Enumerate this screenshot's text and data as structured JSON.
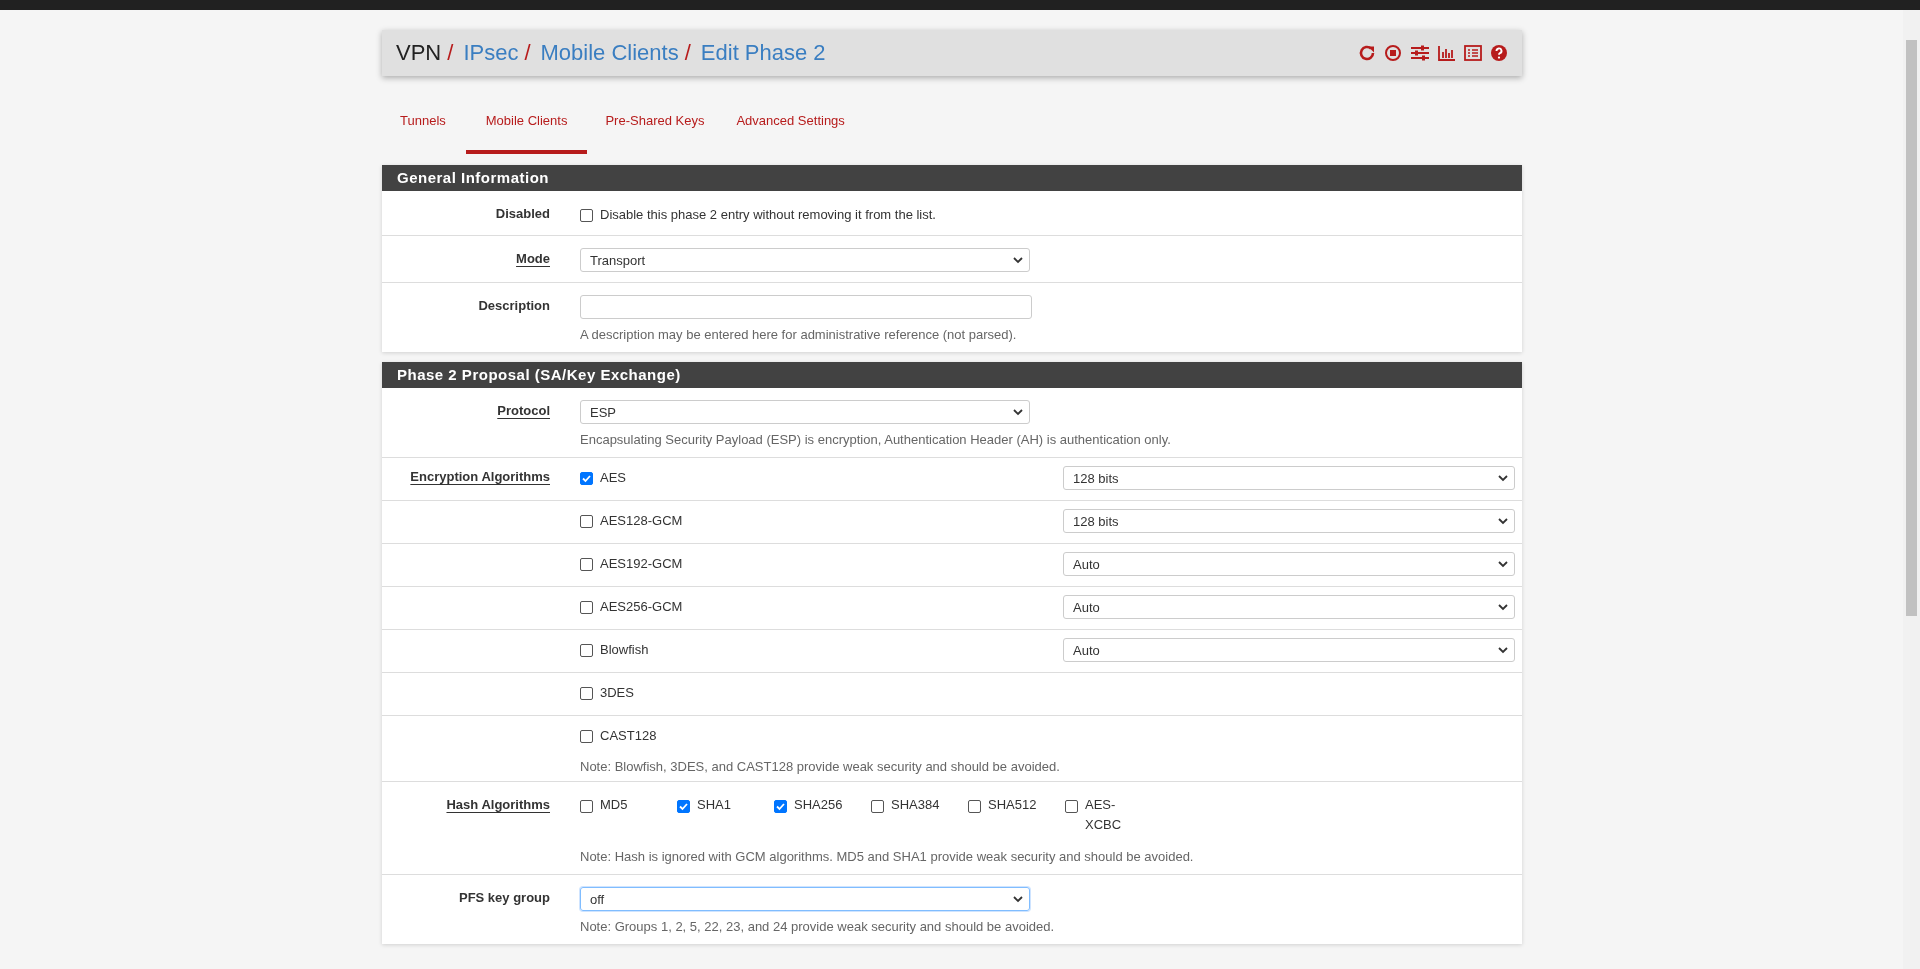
{
  "breadcrumb": [
    {
      "label": "VPN",
      "link": false,
      "separator": "/"
    },
    {
      "label": "IPsec",
      "link": true,
      "separator": "/"
    },
    {
      "label": "Mobile Clients",
      "link": true,
      "separator": "/"
    },
    {
      "label": "Edit Phase 2",
      "link": true
    }
  ],
  "tabs": [
    {
      "label": "Tunnels",
      "selected": false
    },
    {
      "label": "Mobile Clients",
      "selected": true
    },
    {
      "label": "Pre-Shared Keys",
      "selected": false
    },
    {
      "label": "Advanced Settings",
      "selected": false
    }
  ],
  "sections": [
    {
      "title": "General Information",
      "rows": [
        {
          "kind": "checkbox",
          "label": "Disabled",
          "link": false,
          "checked": false,
          "text": "Disable this phase 2 entry without removing it from the list."
        },
        {
          "kind": "select",
          "label": "Mode",
          "link": true,
          "value": "Transport",
          "focused": false
        },
        {
          "kind": "text",
          "label": "Description",
          "link": false,
          "help": "A description may be entered here for administrative reference (not parsed)."
        }
      ]
    },
    {
      "title": "Phase 2 Proposal (SA/Key Exchange)",
      "rows": [
        {
          "kind": "select",
          "label": "Protocol",
          "link": true,
          "value": "ESP",
          "focused": false,
          "help": "Encapsulating Security Payload (ESP) is encryption, Authentication Header (AH) is authentication only."
        },
        {
          "kind": "algorithms",
          "label": "Encryption Algorithms",
          "link": true,
          "items": [
            {
              "name": "AES",
              "checked": true,
              "key_length": "128 bits"
            },
            {
              "name": "AES128-GCM",
              "checked": false,
              "key_length": "128 bits"
            },
            {
              "name": "AES192-GCM",
              "checked": false,
              "key_length": "Auto"
            },
            {
              "name": "AES256-GCM",
              "checked": false,
              "key_length": "Auto"
            },
            {
              "name": "Blowfish",
              "checked": false,
              "key_length": "Auto"
            },
            {
              "name": "3DES",
              "checked": false
            },
            {
              "name": "CAST128",
              "checked": false
            }
          ],
          "help": "Note: Blowfish, 3DES, and CAST128 provide weak security and should be avoided."
        },
        {
          "kind": "hash",
          "label": "Hash Algorithms",
          "link": true,
          "items": [
            {
              "name": "MD5",
              "checked": false
            },
            {
              "name": "SHA1",
              "checked": true
            },
            {
              "name": "SHA256",
              "checked": true
            },
            {
              "name": "SHA384",
              "checked": false
            },
            {
              "name": "SHA512",
              "checked": false
            },
            {
              "name": "AES-XCBC",
              "checked": false
            }
          ],
          "help": "Note: Hash is ignored with GCM algorithms. MD5 and SHA1 provide weak security and should be avoided."
        },
        {
          "kind": "select",
          "label": "PFS key group",
          "link": false,
          "value": "off",
          "focused": true,
          "help": "Note: Groups 1, 2, 5, 22, 23, and 24 provide weak security and should be avoided."
        }
      ]
    }
  ]
}
